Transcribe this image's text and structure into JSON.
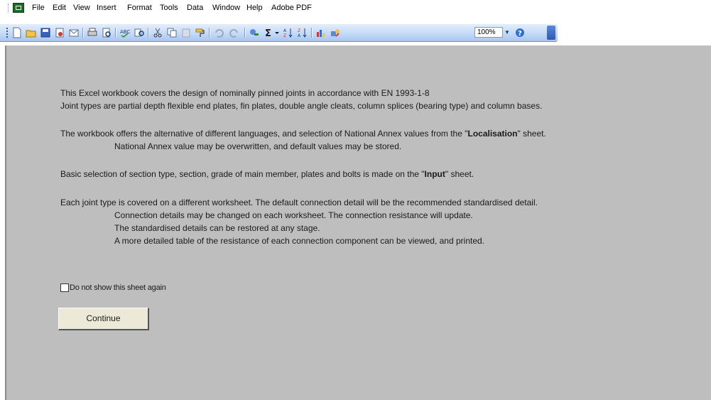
{
  "menu": {
    "items": [
      "File",
      "Edit",
      "View",
      "Insert",
      "Format",
      "Tools",
      "Data",
      "Window",
      "Help",
      "Adobe PDF"
    ]
  },
  "toolbar": {
    "zoom_value": "100%",
    "icons": [
      "new-icon",
      "open-icon",
      "save-icon",
      "permission-icon",
      "email-icon",
      "print-icon",
      "print-preview-icon",
      "spelling-icon",
      "research-icon",
      "cut-icon",
      "copy-icon",
      "paste-icon",
      "format-painter-icon",
      "undo-icon",
      "redo-icon",
      "hyperlink-icon",
      "autosum-icon",
      "sort-ascending-icon",
      "sort-descending-icon",
      "chart-wizard-icon",
      "drawing-icon",
      "zoom-dropdown",
      "help-icon",
      "toolbar-options-icon"
    ]
  },
  "intro": {
    "line1": "This Excel workbook covers the design of nominally pinned joints in accordance with EN 1993-1-8",
    "line2": "Joint types are partial depth flexible end plates, fin plates, double angle cleats, column splices (bearing type) and column bases.",
    "line3_pre": "The workbook offers the alternative of different languages, and selection of National Annex values from the \"",
    "line3_bold": "Localisation",
    "line3_post": "\" sheet.",
    "line4": "National Annex value may be overwritten, and default values may be stored.",
    "line5_pre": "Basic selection of section type, section, grade of main member, plates and bolts is made on the \"",
    "line5_bold": "Input",
    "line5_post": "\" sheet.",
    "line6": "Each joint type is covered on a different worksheet. The default connection detail will be the recommended standardised detail.",
    "line7": "Connection details may be changed on each worksheet. The connection resistance will update.",
    "line8": "The standardised details can be restored at any stage.",
    "line9": "A more detailed table of the resistance of each connection component can be viewed, and printed."
  },
  "checkbox": {
    "label": "Do not show this sheet again",
    "checked": false
  },
  "continue_button": {
    "label": "Continue"
  },
  "colors": {
    "sheet_bg": "#bebebe",
    "toolbar_top": "#e3eefc",
    "toolbar_bottom": "#a9c5ee",
    "button_bg": "#ece9d8"
  }
}
